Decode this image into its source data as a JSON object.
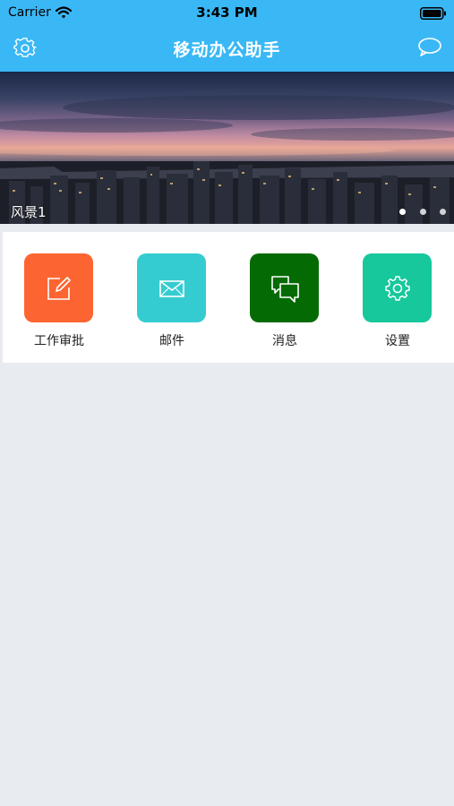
{
  "status_bar": {
    "carrier": "Carrier",
    "time": "3:43 PM",
    "wifi_icon": "wifi-icon",
    "battery_icon": "battery-icon"
  },
  "nav": {
    "title": "移动办公助手",
    "left_icon": "gear-icon",
    "right_icon": "chat-bubble-icon",
    "background": "#3ab8f5"
  },
  "banner": {
    "caption": "风景1",
    "slide_count": 3,
    "active_slide": 1
  },
  "grid": {
    "items": [
      {
        "label": "工作审批",
        "icon": "edit-icon",
        "color": "#fc6531"
      },
      {
        "label": "邮件",
        "icon": "mail-icon",
        "color": "#35ccd1"
      },
      {
        "label": "消息",
        "icon": "message-icon",
        "color": "#046b04"
      },
      {
        "label": "设置",
        "icon": "settings-icon",
        "color": "#16c89b"
      }
    ]
  },
  "colors": {
    "page_background": "#e8ebf0"
  }
}
